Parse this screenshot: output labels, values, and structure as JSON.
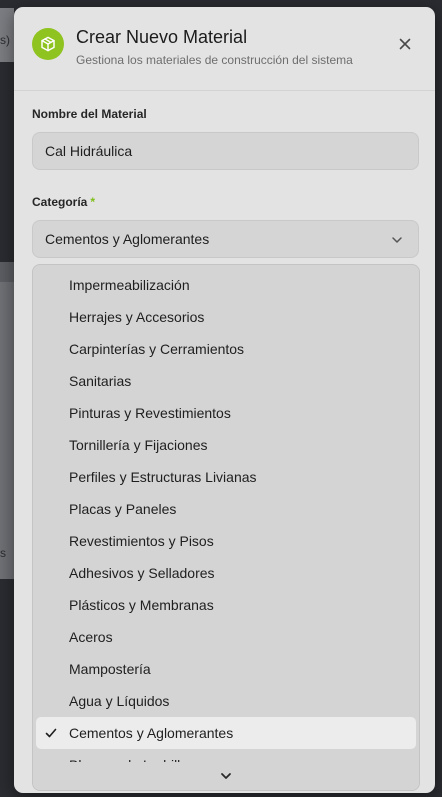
{
  "backdrop": {
    "text_top": "s)",
    "text_bottom": "s"
  },
  "modal": {
    "icon": "package-icon",
    "title": "Crear Nuevo Material",
    "subtitle": "Gestiona los materiales de construcción del sistema",
    "close_icon": "close-icon"
  },
  "form": {
    "name_label": "Nombre del Material",
    "name_value": "Cal Hidráulica",
    "category_label": "Categoría",
    "category_required": "*",
    "category_value": "Cementos y Aglomerantes"
  },
  "dropdown": {
    "options": [
      "Impermeabilización",
      "Herrajes y Accesorios",
      "Carpinterías y Cerramientos",
      "Sanitarias",
      "Pinturas y Revestimientos",
      "Tornillería y Fijaciones",
      "Perfiles y Estructuras Livianas",
      "Placas y Paneles",
      "Revestimientos y Pisos",
      "Adhesivos y Selladores",
      "Plásticos y Membranas",
      "Aceros",
      "Mampostería",
      "Agua y Líquidos",
      "Cementos y Aglomerantes"
    ],
    "selected": "Cementos y Aglomerantes",
    "partial_next": "Bloques de Ladrillo"
  },
  "colors": {
    "accent": "#8fc31f",
    "required": "#7fbf1a"
  }
}
